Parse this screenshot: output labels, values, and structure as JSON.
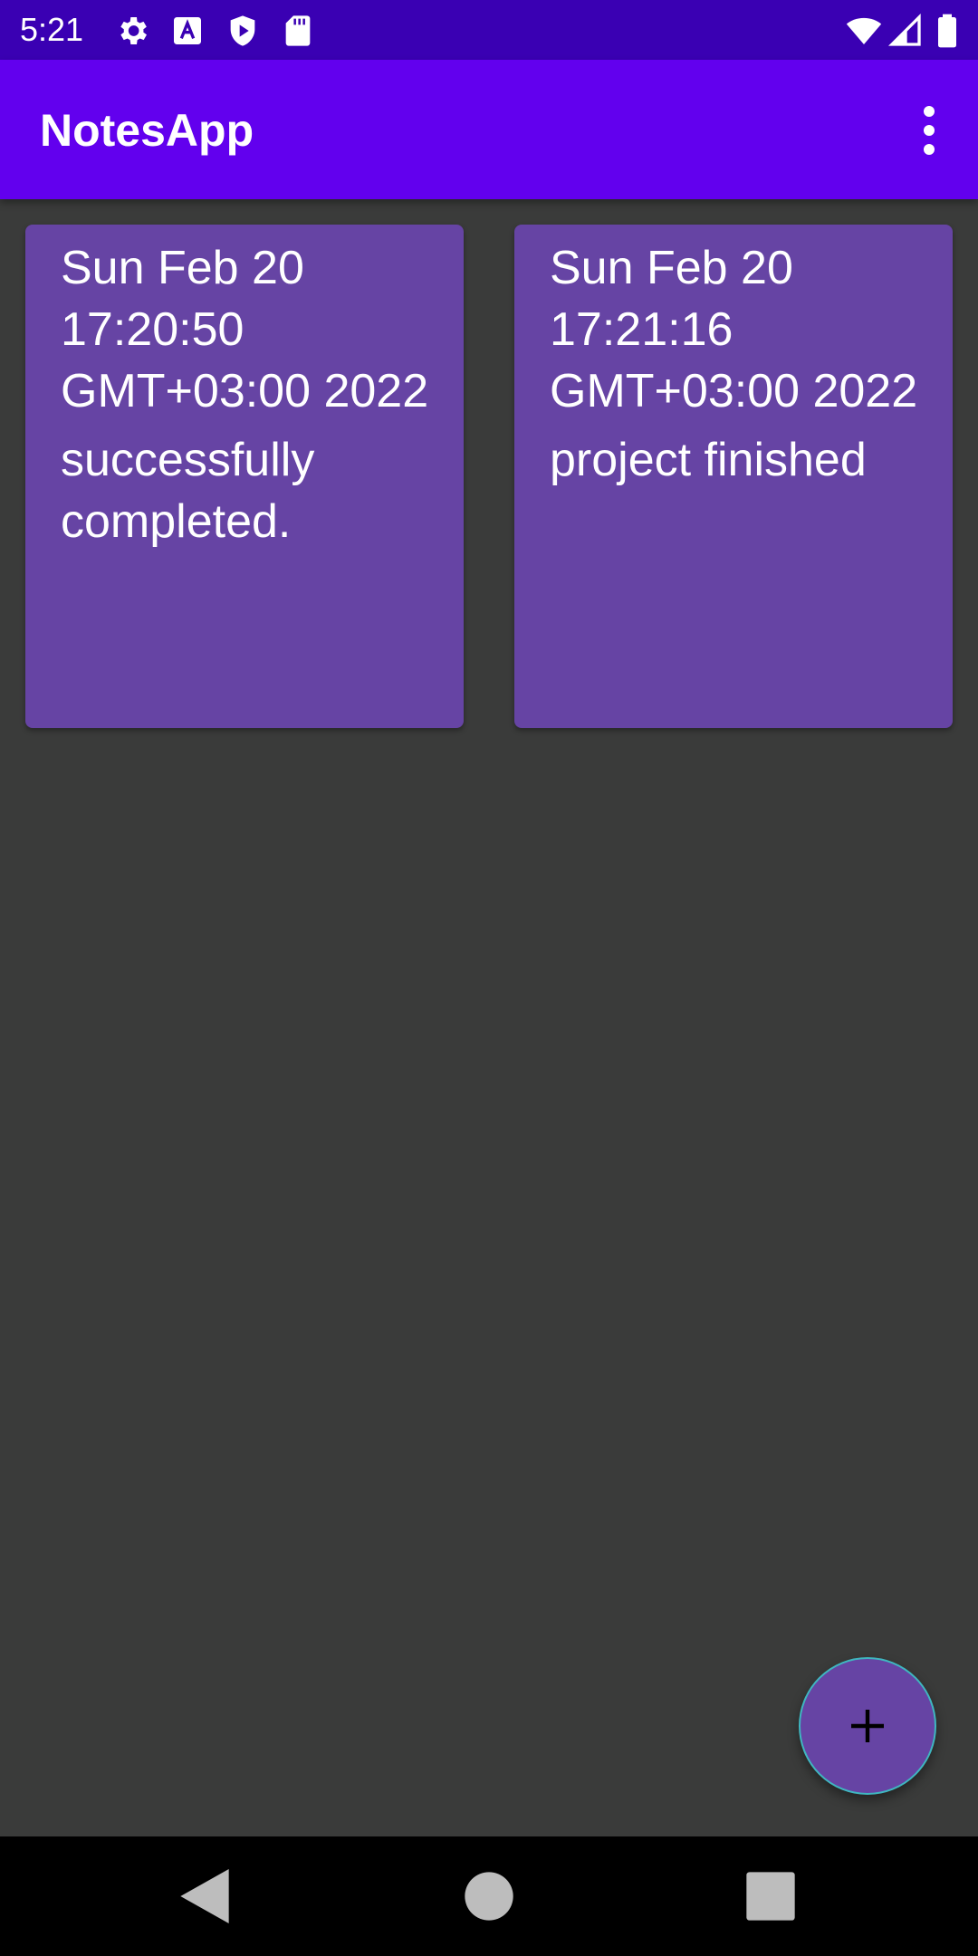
{
  "status_bar": {
    "time": "5:21",
    "left_icons": [
      "settings-icon",
      "a-box-icon",
      "play-shield-icon",
      "sd-card-icon"
    ],
    "right_icons": [
      "wifi-icon",
      "cell-signal-icon",
      "battery-icon"
    ]
  },
  "app_bar": {
    "title": "NotesApp",
    "overflow_icon": "more-vert-icon"
  },
  "notes": [
    {
      "date": "Sun Feb 20 17:20:50 GMT+03:00 2022",
      "text": "successfully completed."
    },
    {
      "date": "Sun Feb 20 17:21:16 GMT+03:00 2022",
      "text": "project finished"
    }
  ],
  "fab": {
    "icon": "add-icon"
  },
  "nav_bar": {
    "buttons": [
      "back-icon",
      "home-icon",
      "recents-icon"
    ]
  },
  "colors": {
    "status_bar": "#3a00b3",
    "app_bar": "#6200ee",
    "background": "#3a3b3a",
    "note_card": "#6644a4",
    "fab": "#6644a4",
    "fab_border": "#3fb6c0",
    "nav_bar": "#000000"
  }
}
